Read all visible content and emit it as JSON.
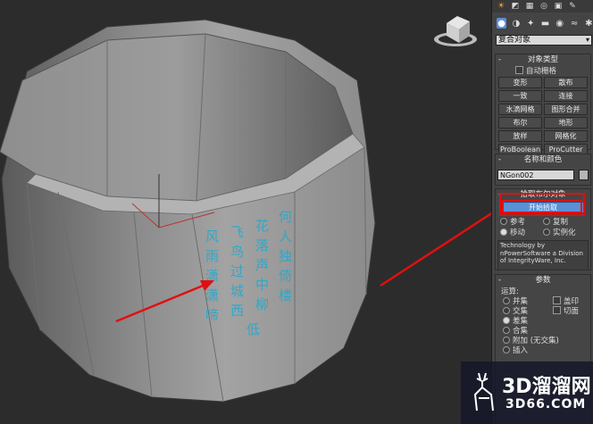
{
  "tabs": [
    {
      "icon": "sun-icon",
      "glyph": "☀"
    },
    {
      "icon": "curve-icon",
      "glyph": "◩"
    },
    {
      "icon": "hierarchy-icon",
      "glyph": "▦"
    },
    {
      "icon": "motion-icon",
      "glyph": "◎"
    },
    {
      "icon": "display-icon",
      "glyph": "▣"
    },
    {
      "icon": "utilities-icon",
      "glyph": "✎"
    }
  ],
  "category_icons": [
    {
      "icon": "geometry-icon",
      "glyph": "●"
    },
    {
      "icon": "shapes-icon",
      "glyph": "◑"
    },
    {
      "icon": "lights-icon",
      "glyph": "✦"
    },
    {
      "icon": "cameras-icon",
      "glyph": "▬"
    },
    {
      "icon": "helpers-icon",
      "glyph": "◉"
    },
    {
      "icon": "spacewarps-icon",
      "glyph": "≈"
    },
    {
      "icon": "systems-icon",
      "glyph": "✱"
    }
  ],
  "dropdown": {
    "value": "复合对象",
    "arrow": "▾"
  },
  "object_type": {
    "title": "对象类型",
    "autogrid": "自动栅格",
    "buttons": [
      "变形",
      "散布",
      "一致",
      "连接",
      "水滴网格",
      "图形合并",
      "布尔",
      "地形",
      "放样",
      "网格化",
      "ProBoolean",
      "ProCutter"
    ]
  },
  "name_color": {
    "title": "名称和颜色",
    "name": "NGon002"
  },
  "pick": {
    "title": "拾取布尔对象",
    "button": "开始拾取",
    "options": [
      "参考",
      "复制",
      "移动",
      "实例化"
    ],
    "selected": 2,
    "info": "Technology by nPowerSoftware a Division of IntegrityWare, Inc."
  },
  "params": {
    "title": "参数",
    "ops_label": "运算:",
    "ops": [
      "并集",
      "交集",
      "差集",
      "合集",
      "附加 (无交集)",
      "插入"
    ],
    "selected": 2,
    "checks": [
      "盖印",
      "切面"
    ]
  },
  "rollout_sign": {
    "open": "-"
  },
  "watermark": {
    "line1": "3D溜溜网",
    "line2": "3D66.COM"
  },
  "colors": {
    "highlight": "#5b8fd6",
    "annotation": "#e01010",
    "text_blue": "#2fa8c8"
  }
}
